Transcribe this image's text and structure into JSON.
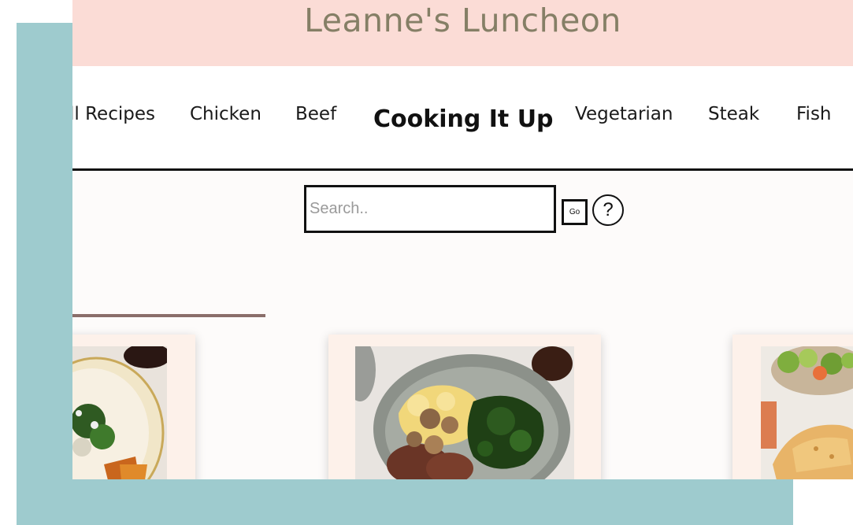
{
  "header": {
    "title": "Leanne's Luncheon"
  },
  "nav": {
    "brand": "Cooking It Up",
    "items_left": [
      "ll Recipes",
      "Chicken",
      "Beef"
    ],
    "items_right": [
      "Vegetarian",
      "Steak",
      "Fish"
    ]
  },
  "search": {
    "placeholder": "Search..",
    "value": "",
    "go_label": "Go",
    "help_label": "?"
  },
  "colors": {
    "banner": "#fbdcd6",
    "frame": "#9ecbce",
    "card_bg": "#fdf1ea",
    "rule": "#8a6e6a",
    "title": "#857f66"
  },
  "cards": [
    {
      "image": "plate-salad-roast-vegetables"
    },
    {
      "image": "plate-steak-mashed-potatoes-mushrooms-greens"
    },
    {
      "image": "salad-bowl-bread-drink"
    }
  ]
}
